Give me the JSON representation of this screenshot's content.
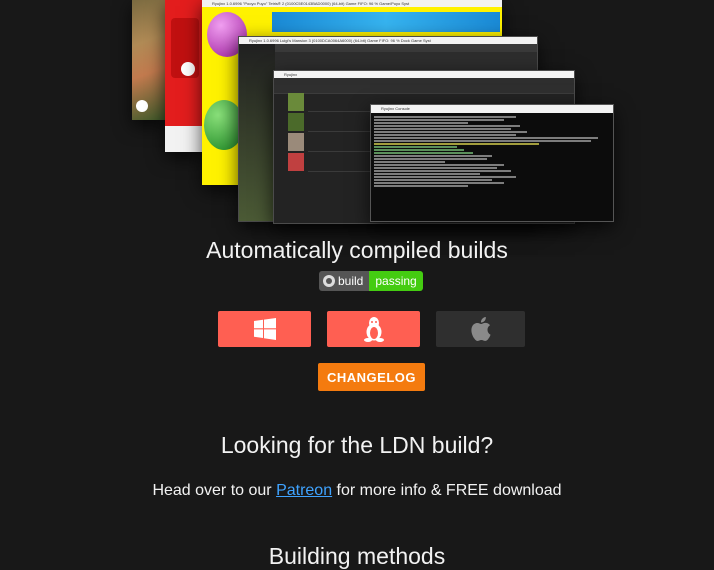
{
  "hero": {
    "window_titles": [
      "Ryujinx 1.0.6996 \"Pooyo Puyo\" Tetris® 2 (0100C5E0143BAD0000) (64-bit) Game FIFO: 96 % Game/Puyo Syst",
      "Ryujinx 1.0.6996 Luigi's Mansion 3 (0100DCA0064A6000) (64-bit) Game FIFO: 96 % Dock Game Syst",
      "Ryujinx",
      "Ryujinx Console"
    ],
    "menu_items": [
      "File",
      "Options",
      "Tools",
      "Help"
    ],
    "table_headers": [
      "Fav",
      "Icon",
      "Application",
      "Developer",
      "Version",
      "Time Played",
      "Last Played",
      "File Ext",
      "File Size",
      "Path"
    ]
  },
  "builds": {
    "title": "Automatically compiled builds",
    "badge_left": "build",
    "badge_right": "passing"
  },
  "downloads": {
    "windows_icon": "windows-logo-icon",
    "linux_icon": "linux-tux-icon",
    "mac_icon": "apple-logo-icon"
  },
  "changelog_label": "CHANGELOG",
  "ldn": {
    "title": "Looking for the LDN build?",
    "text_before": "Head over to our ",
    "link": "Patreon",
    "text_after": " for more info & FREE download"
  },
  "methods_title": "Building methods",
  "colors": {
    "background": "#181818",
    "os_button": "#ff5f52",
    "mac_button": "#2f2f2f",
    "changelog": "#f47b0f",
    "badge_pass": "#44cc11",
    "link": "#3fa3ff"
  }
}
